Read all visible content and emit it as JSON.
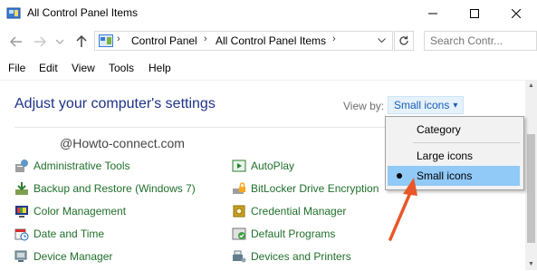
{
  "window": {
    "title": "All Control Panel Items",
    "minimize_glyph": "—",
    "maximize_glyph": "☐",
    "close_glyph": "✕"
  },
  "address": {
    "crumbs": [
      "Control Panel",
      "All Control Panel Items"
    ],
    "separator": "›"
  },
  "search": {
    "placeholder": "Search Contr..."
  },
  "menu": [
    "File",
    "Edit",
    "View",
    "Tools",
    "Help"
  ],
  "header": {
    "heading": "Adjust your computer's settings",
    "viewby_label": "View by:",
    "viewby_value": "Small icons",
    "viewby_caret": "▾"
  },
  "watermark": "@Howto-connect.com",
  "items_col1": [
    {
      "label": "Administrative Tools",
      "icon": "admin-tools-icon"
    },
    {
      "label": "Backup and Restore (Windows 7)",
      "icon": "backup-icon"
    },
    {
      "label": "Color Management",
      "icon": "color-management-icon"
    },
    {
      "label": "Date and Time",
      "icon": "date-time-icon"
    },
    {
      "label": "Device Manager",
      "icon": "device-manager-icon"
    }
  ],
  "items_col2": [
    {
      "label": "AutoPlay",
      "icon": "autoplay-icon"
    },
    {
      "label": "BitLocker Drive Encryption",
      "icon": "bitlocker-icon"
    },
    {
      "label": "Credential Manager",
      "icon": "credential-manager-icon"
    },
    {
      "label": "Default Programs",
      "icon": "default-programs-icon"
    },
    {
      "label": "Devices and Printers",
      "icon": "devices-printers-icon"
    }
  ],
  "dropdown": {
    "options": [
      "Category",
      "Large icons",
      "Small icons"
    ],
    "selected": "Small icons"
  },
  "colors": {
    "heading": "#1e3287",
    "link": "#1f6f2a",
    "accent": "#1a5db5",
    "selection": "#91c9f7",
    "annotation_arrow": "#e8572a"
  }
}
